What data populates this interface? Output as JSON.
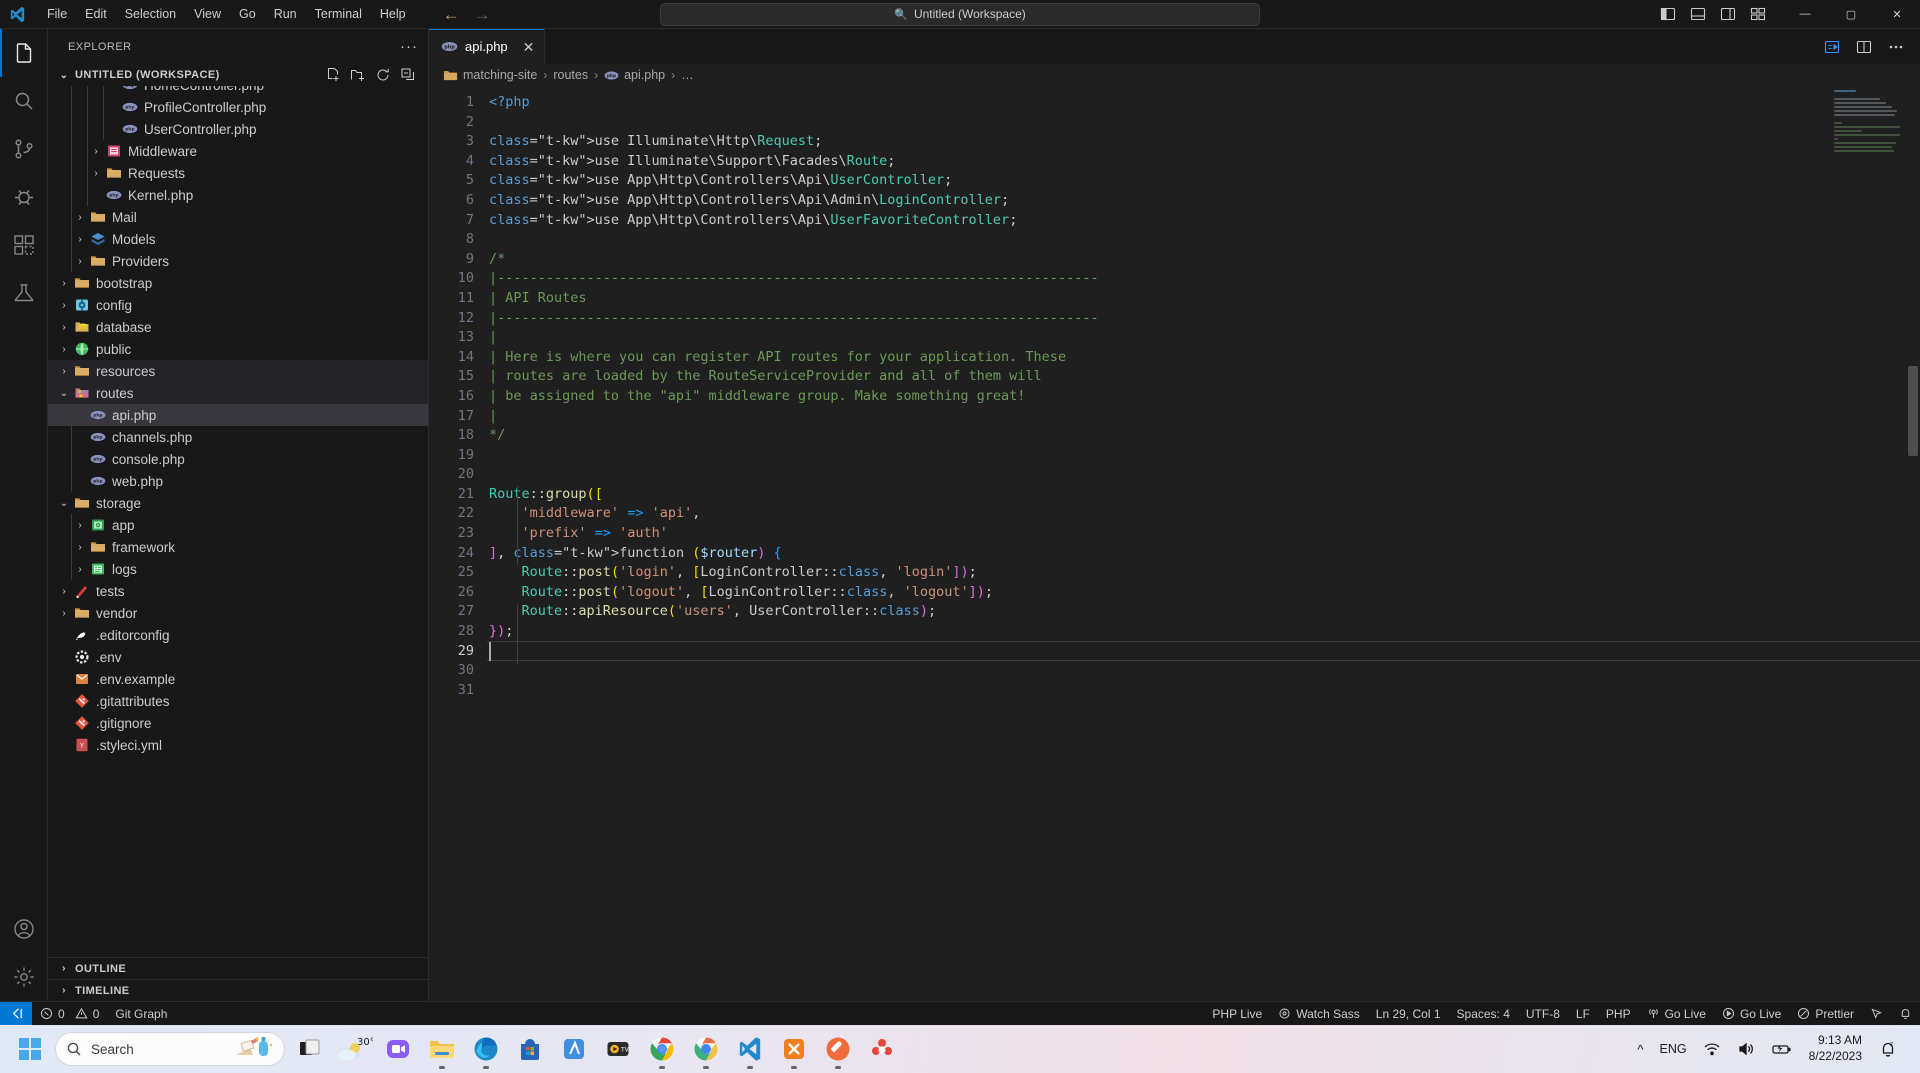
{
  "titlebar": {
    "menu": [
      "File",
      "Edit",
      "Selection",
      "View",
      "Go",
      "Run",
      "Terminal",
      "Help"
    ],
    "command_center_text": "Untitled (Workspace)",
    "back_arrow": "←",
    "forward_arrow": "→",
    "minimize": "—",
    "maximize": "▢",
    "close": "✕"
  },
  "activitybar": {
    "items": [
      {
        "name": "explorer",
        "icon": "files-icon",
        "active": true
      },
      {
        "name": "search",
        "icon": "search-icon",
        "active": false
      },
      {
        "name": "source-control",
        "icon": "source-control-icon",
        "active": false
      },
      {
        "name": "run-and-debug",
        "icon": "debug-icon",
        "active": false
      },
      {
        "name": "extensions",
        "icon": "extensions-icon",
        "active": false
      },
      {
        "name": "testing",
        "icon": "beaker-icon",
        "active": false
      }
    ],
    "bottom": [
      {
        "name": "accounts",
        "icon": "account-icon"
      },
      {
        "name": "settings",
        "icon": "gear-icon"
      }
    ]
  },
  "sidebar": {
    "title": "EXPLORER",
    "more_actions": "···",
    "workspace_label": "UNTITLED (WORKSPACE)",
    "header_actions": [
      "new-file-icon",
      "new-folder-icon",
      "refresh-icon",
      "collapse-all-icon"
    ],
    "tree": [
      {
        "label": "HomeController.php",
        "depth": 4,
        "type": "php",
        "state": "none",
        "clipped": true
      },
      {
        "label": "ProfileController.php",
        "depth": 4,
        "type": "php",
        "state": "none"
      },
      {
        "label": "UserController.php",
        "depth": 4,
        "type": "php",
        "state": "none"
      },
      {
        "label": "Middleware",
        "depth": 3,
        "type": "folder-middleware",
        "state": "collapsed"
      },
      {
        "label": "Requests",
        "depth": 3,
        "type": "folder",
        "state": "collapsed"
      },
      {
        "label": "Kernel.php",
        "depth": 3,
        "type": "php",
        "state": "none"
      },
      {
        "label": "Mail",
        "depth": 2,
        "type": "folder",
        "state": "collapsed"
      },
      {
        "label": "Models",
        "depth": 2,
        "type": "folder-models",
        "state": "collapsed"
      },
      {
        "label": "Providers",
        "depth": 2,
        "type": "folder",
        "state": "collapsed"
      },
      {
        "label": "bootstrap",
        "depth": 1,
        "type": "folder",
        "state": "collapsed"
      },
      {
        "label": "config",
        "depth": 1,
        "type": "folder-config",
        "state": "collapsed"
      },
      {
        "label": "database",
        "depth": 1,
        "type": "folder-database",
        "state": "collapsed"
      },
      {
        "label": "public",
        "depth": 1,
        "type": "folder-public",
        "state": "collapsed"
      },
      {
        "label": "resources",
        "depth": 1,
        "type": "folder",
        "state": "collapsed",
        "highlight": true
      },
      {
        "label": "routes",
        "depth": 1,
        "type": "folder-routes",
        "state": "expanded",
        "highlight": true
      },
      {
        "label": "api.php",
        "depth": 2,
        "type": "php",
        "state": "none",
        "selected": true
      },
      {
        "label": "channels.php",
        "depth": 2,
        "type": "php",
        "state": "none"
      },
      {
        "label": "console.php",
        "depth": 2,
        "type": "php",
        "state": "none"
      },
      {
        "label": "web.php",
        "depth": 2,
        "type": "php",
        "state": "none"
      },
      {
        "label": "storage",
        "depth": 1,
        "type": "folder",
        "state": "expanded"
      },
      {
        "label": "app",
        "depth": 2,
        "type": "folder-app",
        "state": "collapsed"
      },
      {
        "label": "framework",
        "depth": 2,
        "type": "folder",
        "state": "collapsed"
      },
      {
        "label": "logs",
        "depth": 2,
        "type": "folder-logs",
        "state": "collapsed"
      },
      {
        "label": "tests",
        "depth": 1,
        "type": "folder-tests",
        "state": "collapsed"
      },
      {
        "label": "vendor",
        "depth": 1,
        "type": "folder",
        "state": "collapsed"
      },
      {
        "label": ".editorconfig",
        "depth": 1,
        "type": "editorconfig",
        "state": "none"
      },
      {
        "label": ".env",
        "depth": 1,
        "type": "env",
        "state": "none"
      },
      {
        "label": ".env.example",
        "depth": 1,
        "type": "env-example",
        "state": "none"
      },
      {
        "label": ".gitattributes",
        "depth": 1,
        "type": "git",
        "state": "none"
      },
      {
        "label": ".gitignore",
        "depth": 1,
        "type": "git",
        "state": "none"
      },
      {
        "label": ".styleci.yml",
        "depth": 1,
        "type": "yml",
        "state": "none",
        "clipped_bottom": true
      }
    ],
    "outline_label": "OUTLINE",
    "timeline_label": "TIMELINE"
  },
  "editor": {
    "tab": {
      "label": "api.php",
      "icon": "php-icon",
      "close": "✕"
    },
    "tab_actions": [
      "split-editor-icon",
      "open-changes-icon",
      "more-actions-icon"
    ],
    "breadcrumbs": [
      {
        "label": "matching-site",
        "icon": "folder-icon"
      },
      {
        "label": "routes",
        "icon": ""
      },
      {
        "label": "api.php",
        "icon": "php-icon"
      },
      {
        "label": "…",
        "icon": ""
      }
    ],
    "line_count": 31,
    "first_line": 1,
    "cursor_line": 29,
    "lines": [
      "<?php",
      "",
      "use Illuminate\\Http\\Request;",
      "use Illuminate\\Support\\Facades\\Route;",
      "use App\\Http\\Controllers\\Api\\UserController;",
      "use App\\Http\\Controllers\\Api\\Admin\\LoginController;",
      "use App\\Http\\Controllers\\Api\\UserFavoriteController;",
      "",
      "/*",
      "|--------------------------------------------------------------------------",
      "| API Routes",
      "|--------------------------------------------------------------------------",
      "|",
      "| Here is where you can register API routes for your application. These",
      "| routes are loaded by the RouteServiceProvider and all of them will",
      "| be assigned to the \"api\" middleware group. Make something great!",
      "|",
      "*/",
      "",
      "",
      "Route::group([",
      "    'middleware' => 'api',",
      "    'prefix' => 'auth'",
      "], function ($router) {",
      "    Route::post('login', [LoginController::class, 'login']);",
      "    Route::post('logout', [LoginController::class, 'logout']);",
      "    Route::apiResource('users', UserController::class);",
      "});",
      "",
      "",
      ""
    ]
  },
  "statusbar": {
    "remote_icon": "remote-indicator-icon",
    "left": [
      {
        "label": "0",
        "icon": "error-icon",
        "name": "errors"
      },
      {
        "label": "0",
        "icon": "warning-icon",
        "name": "warnings"
      },
      {
        "label": "Git Graph",
        "icon": "",
        "name": "git-graph"
      }
    ],
    "right": [
      {
        "label": "PHP Live",
        "icon": "",
        "name": "php-live"
      },
      {
        "label": "Watch Sass",
        "icon": "eye-icon",
        "name": "watch-sass"
      },
      {
        "label": "Ln 29, Col 1",
        "icon": "",
        "name": "cursor-position"
      },
      {
        "label": "Spaces: 4",
        "icon": "",
        "name": "indentation"
      },
      {
        "label": "UTF-8",
        "icon": "",
        "name": "encoding"
      },
      {
        "label": "LF",
        "icon": "",
        "name": "eol"
      },
      {
        "label": "PHP",
        "icon": "",
        "name": "language-mode"
      },
      {
        "label": "Go Live",
        "icon": "broadcast-icon",
        "name": "go-live-1"
      },
      {
        "label": "Go Live",
        "icon": "play-circle-icon",
        "name": "go-live-2"
      },
      {
        "label": "Prettier",
        "icon": "check-circle-icon",
        "name": "prettier"
      },
      {
        "label": "",
        "icon": "feedback-icon",
        "name": "feedback"
      },
      {
        "label": "",
        "icon": "bell-icon",
        "name": "notifications"
      }
    ]
  },
  "taskbar": {
    "start_name": "start-button",
    "search_placeholder": "Search",
    "apps": [
      {
        "name": "task-view",
        "running": false
      },
      {
        "name": "weather-widget",
        "label": "30°",
        "running": false
      },
      {
        "name": "microsoft-teams",
        "running": false
      },
      {
        "name": "file-explorer",
        "running": true
      },
      {
        "name": "microsoft-edge",
        "running": true
      },
      {
        "name": "microsoft-store",
        "running": false
      },
      {
        "name": "app-blue",
        "running": false
      },
      {
        "name": "media-player",
        "running": false
      },
      {
        "name": "google-chrome",
        "running": true
      },
      {
        "name": "google-chrome-beta",
        "running": true
      },
      {
        "name": "visual-studio-code",
        "running": true,
        "active": true
      },
      {
        "name": "xampp-control-panel",
        "running": true
      },
      {
        "name": "postman",
        "running": true
      },
      {
        "name": "app-red",
        "running": false
      }
    ],
    "tray": {
      "chevron": "^",
      "language": "ENG",
      "icons": [
        "wifi-icon",
        "volume-icon",
        "battery-icon"
      ],
      "time": "9:13 AM",
      "date": "8/22/2023",
      "notifications_icon": "bell-sleep-icon"
    }
  },
  "colors": {
    "accent": "#0078d4",
    "editor_bg": "#1f1f1f",
    "chrome_bg": "#181818",
    "keyword": "#569cd6",
    "string": "#ce9178",
    "comment": "#6a9955",
    "type": "#4ec9b0",
    "function": "#dcdcaa",
    "control": "#c586c0"
  }
}
